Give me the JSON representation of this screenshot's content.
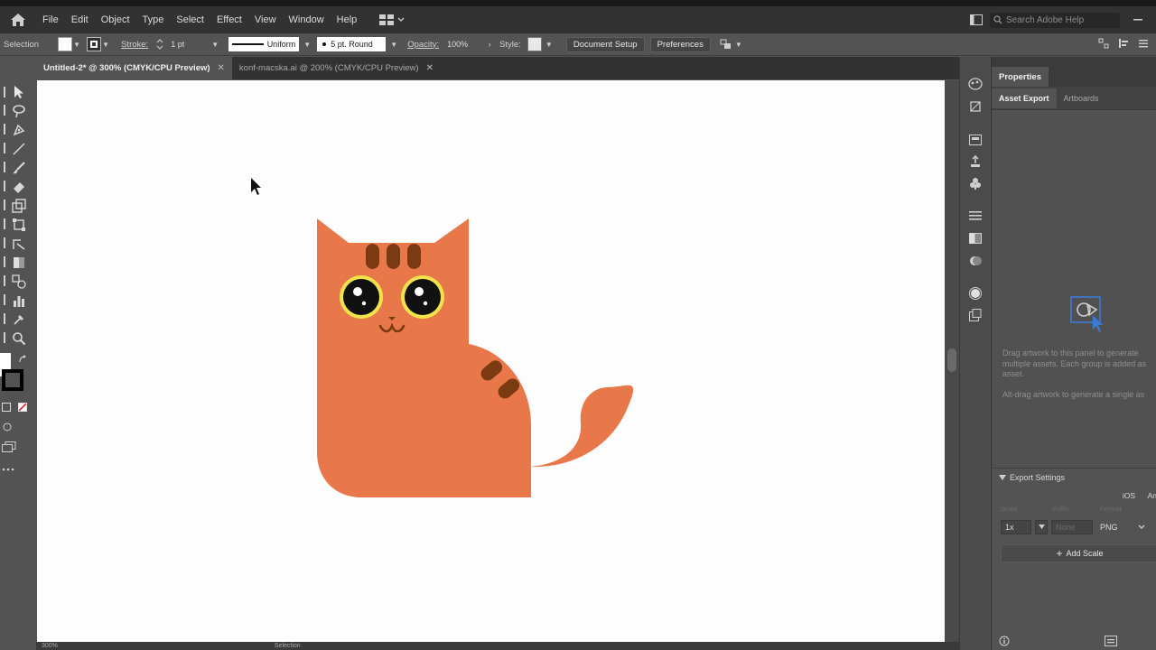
{
  "menubar": {
    "items": [
      "File",
      "Edit",
      "Object",
      "Type",
      "Select",
      "Effect",
      "View",
      "Window",
      "Help"
    ],
    "search_placeholder": "Search Adobe Help"
  },
  "control_bar": {
    "mode_label": "Selection",
    "stroke_label": "Stroke:",
    "stroke_weight": "1 pt",
    "stroke_profile": "Uniform",
    "brush": "5 pt. Round",
    "opacity_label": "Opacity:",
    "opacity_value": "100%",
    "style_label": "Style:",
    "document_setup": "Document Setup",
    "preferences": "Preferences"
  },
  "tabs": [
    {
      "label": "Untitled-2* @ 300% (CMYK/CPU Preview)",
      "active": true
    },
    {
      "label": "konf-macska.ai @ 200% (CMYK/CPU Preview)",
      "active": false
    }
  ],
  "status": {
    "zoom": "300%",
    "mode": "Selection"
  },
  "panel": {
    "title": "Properties",
    "tabs": [
      "Asset Export",
      "Artboards"
    ],
    "description": "Drag artwork to this panel to generate multiple assets. Each group is added as asset.",
    "description2": "Alt-drag artwork to generate a single as",
    "export_settings": {
      "title": "Export Settings",
      "ios": "iOS",
      "android": "An",
      "scale_label": "Scale",
      "suffix_label": "Suffix",
      "format_label": "Format",
      "scale": "1x",
      "suffix_placeholder": "None",
      "format": "PNG",
      "add_scale": "Add Scale"
    }
  },
  "colors": {
    "cat_body": "#E8774A",
    "cat_stripes": "#7A3A12",
    "eye_ring": "#F2E34B",
    "canvas": "#FDFDFD",
    "ui_dark": "#323232",
    "ui_mid": "#535353",
    "accent_blue": "#3D7AD8"
  }
}
